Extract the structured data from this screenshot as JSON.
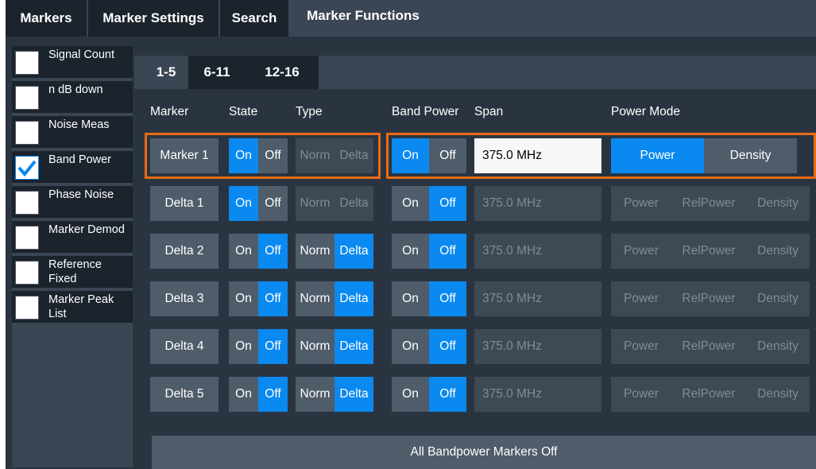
{
  "top_tabs": [
    {
      "label": "Markers",
      "active": false
    },
    {
      "label": "Marker Settings",
      "active": false
    },
    {
      "label": "Search",
      "active": false
    },
    {
      "label": "Marker Functions",
      "active": true
    }
  ],
  "functions": [
    {
      "label": "Signal Count",
      "checked": false
    },
    {
      "label": "n dB down",
      "checked": false
    },
    {
      "label": "Noise Meas",
      "checked": false
    },
    {
      "label": "Band Power",
      "checked": true
    },
    {
      "label": "Phase Noise",
      "checked": false
    },
    {
      "label": "Marker Demod",
      "checked": false
    },
    {
      "label": "Reference Fixed",
      "checked": false
    },
    {
      "label": "Marker Peak List",
      "checked": false
    }
  ],
  "sub_tabs": [
    {
      "label": "1-5",
      "active": true
    },
    {
      "label": "6-11",
      "active": false
    },
    {
      "label": "12-16",
      "active": false
    }
  ],
  "headers": {
    "marker": "Marker",
    "state": "State",
    "type": "Type",
    "band_power": "Band Power",
    "span": "Span",
    "power_mode": "Power Mode"
  },
  "labels": {
    "on": "On",
    "off": "Off",
    "norm": "Norm",
    "delta": "Delta",
    "power": "Power",
    "relpower": "RelPower",
    "density": "Density"
  },
  "rows": [
    {
      "marker": "Marker 1",
      "state": "On",
      "type": "Norm",
      "band_power": "On",
      "span": "375.0 MHz",
      "power_mode": "Power"
    },
    {
      "marker": "Delta 1",
      "state": "On",
      "type": "Delta",
      "band_power": "Off",
      "span": "375.0 MHz",
      "power_mode": ""
    },
    {
      "marker": "Delta 2",
      "state": "Off",
      "type": "Delta",
      "band_power": "Off",
      "span": "375.0 MHz",
      "power_mode": ""
    },
    {
      "marker": "Delta 3",
      "state": "Off",
      "type": "Delta",
      "band_power": "Off",
      "span": "375.0 MHz",
      "power_mode": ""
    },
    {
      "marker": "Delta 4",
      "state": "Off",
      "type": "Delta",
      "band_power": "Off",
      "span": "375.0 MHz",
      "power_mode": ""
    },
    {
      "marker": "Delta 5",
      "state": "Off",
      "type": "Delta",
      "band_power": "Off",
      "span": "375.0 MHz",
      "power_mode": ""
    }
  ],
  "all_off_label": "All Bandpower Markers Off",
  "colors": {
    "accent": "#0a89f0",
    "highlight": "#ec6a15",
    "panel": "#2a3440"
  }
}
